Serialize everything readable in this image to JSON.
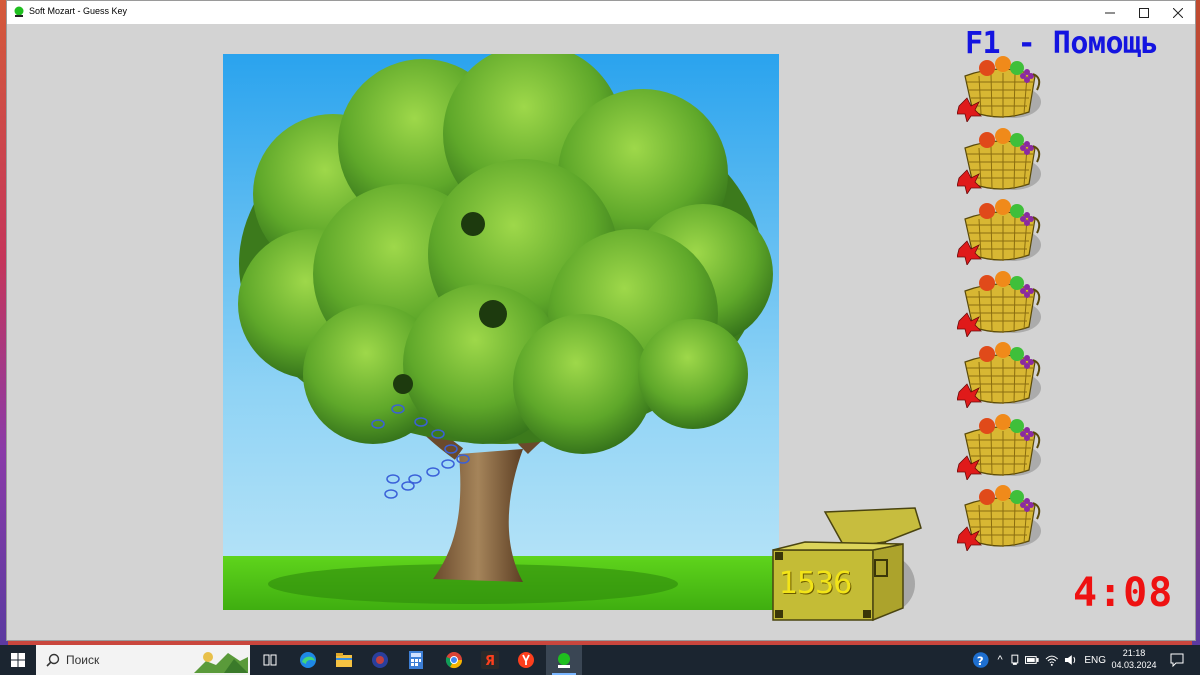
{
  "window": {
    "title": "Soft Mozart - Guess Key",
    "controls": [
      "—",
      "☐",
      "✕"
    ]
  },
  "game": {
    "help_text": "F1 - Помощь",
    "chest_count": "1536",
    "timer": "4:08",
    "baskets_remaining": 7,
    "colors": {
      "help": "#1414e0",
      "timer": "#ee1111",
      "chest_count": "#f2e418",
      "background": "#d3d3d3"
    }
  },
  "taskbar": {
    "search_placeholder": "Поиск",
    "icons": [
      "start-icon",
      "task-view-icon",
      "edge-icon",
      "file-explorer-icon",
      "app-blue-icon",
      "calculator-icon",
      "chrome-icon",
      "yandex-icon",
      "yandex-browser-icon",
      "soft-mozart-icon"
    ],
    "language": "ENG",
    "time": "21:18",
    "date": "04.03.2024"
  }
}
